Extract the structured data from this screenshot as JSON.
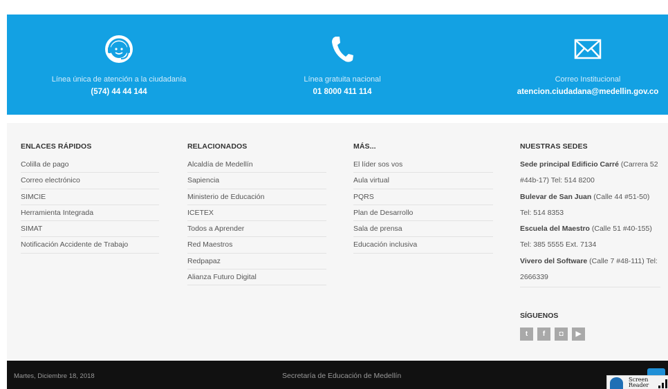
{
  "contact": {
    "items": [
      {
        "icon": "headset-icon",
        "label": "Línea única de atención a la ciudadanía",
        "value": "(574) 44 44 144"
      },
      {
        "icon": "phone-icon",
        "label": "Línea gratuita nacional",
        "value": "01 8000 411 114"
      },
      {
        "icon": "envelope-icon",
        "label": "Correo Institucional",
        "value": "atencion.ciudadana@medellin.gov.co"
      }
    ]
  },
  "footer": {
    "col1": {
      "title": "ENLACES RÁPIDOS",
      "items": [
        "Colilla de pago",
        "Correo electrónico",
        "SIMCIE",
        "Herramienta Integrada",
        "SIMAT",
        "Notificación Accidente de Trabajo"
      ]
    },
    "col2": {
      "title": "RELACIONADOS",
      "items": [
        "Alcaldía de Medellín",
        "Sapiencia",
        "Ministerio de Educación",
        "ICETEX",
        "Todos a Aprender",
        "Red Maestros",
        "Redpapaz",
        "Alianza Futuro Digital"
      ]
    },
    "col3": {
      "title": "MÁS...",
      "items": [
        "El líder sos vos",
        "Aula virtual",
        "PQRS",
        "Plan de Desarrollo",
        "Sala de prensa",
        "Educación inclusiva"
      ]
    },
    "sedes": {
      "title": "NUESTRAS SEDES",
      "items": [
        {
          "name": "Sede principal Edificio Carré",
          "detail": " (Carrera 52 #44b-17) Tel: 514 8200"
        },
        {
          "name": "Bulevar de San Juan",
          "detail": " (Calle 44 #51-50) Tel: 514 8353"
        },
        {
          "name": "Escuela del Maestro",
          "detail": " (Calle 51 #40-155) Tel: 385 5555 Ext. 7134"
        },
        {
          "name": "Vivero del Software",
          "detail": " (Calle 7 #48-111) Tel: 2666339"
        }
      ]
    },
    "follow": {
      "title": "SÍGUENOS",
      "social": [
        {
          "icon": "twitter-icon",
          "glyph": "t"
        },
        {
          "icon": "facebook-icon",
          "glyph": "f"
        },
        {
          "icon": "instagram-icon",
          "glyph": "◘"
        },
        {
          "icon": "youtube-icon",
          "glyph": "▶"
        }
      ]
    }
  },
  "bottom": {
    "date": "Martes, Diciembre 18, 2018",
    "center": "Secretaría de Educación de Medellín",
    "screen_reader_line1": "Screen",
    "screen_reader_line2": "Reader"
  }
}
